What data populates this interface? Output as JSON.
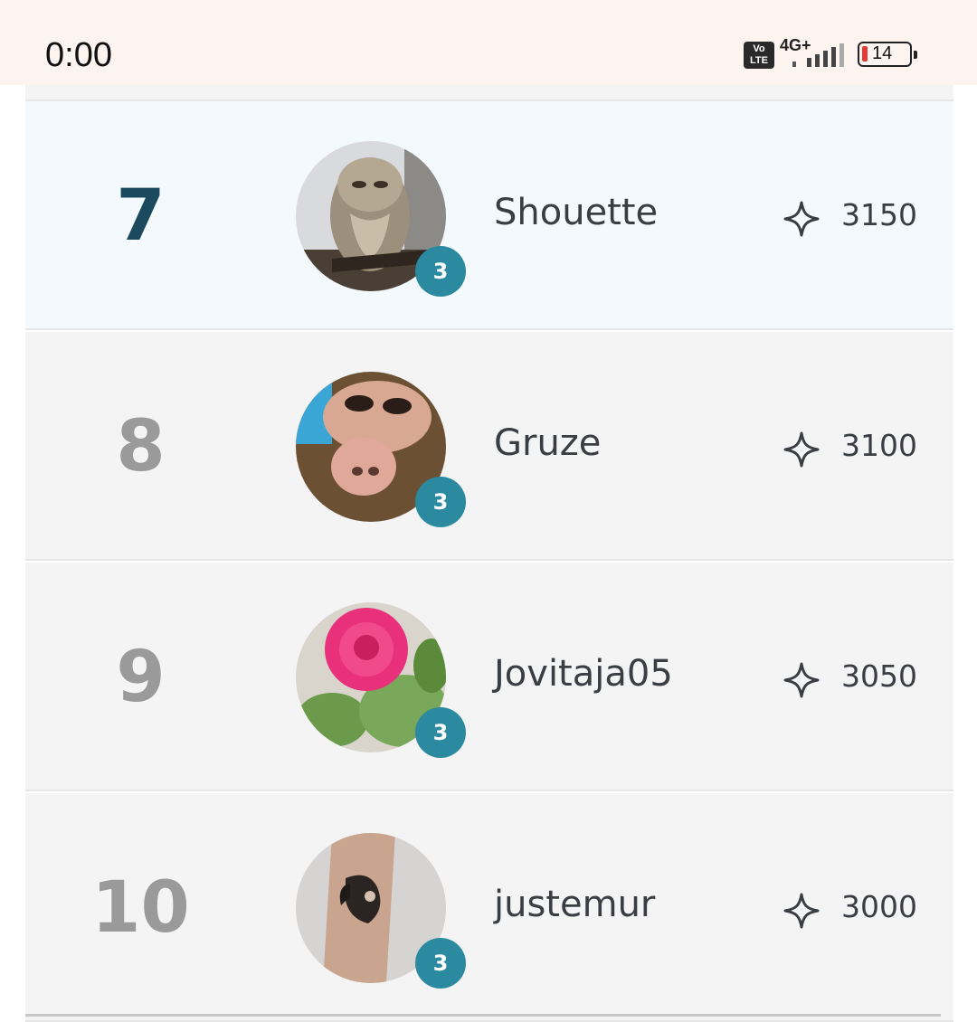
{
  "status_bar": {
    "time": "0:00",
    "volte": "Vo LTE",
    "network": "4G+",
    "battery": "14",
    "battery_color": "#e53935"
  },
  "leaderboard": {
    "accent_color": "#2b8aa0",
    "rows": [
      {
        "rank": "7",
        "username": "Shouette",
        "level": "3",
        "score": "3150",
        "avatar": "owl-photo",
        "highlighted": true
      },
      {
        "rank": "8",
        "username": "Gruze",
        "level": "3",
        "score": "3100",
        "avatar": "alf-puppet-photo",
        "highlighted": false
      },
      {
        "rank": "9",
        "username": "Jovitaja05",
        "level": "3",
        "score": "3050",
        "avatar": "pink-rose-photo",
        "highlighted": false
      },
      {
        "rank": "10",
        "username": "justemur",
        "level": "3",
        "score": "3000",
        "avatar": "tattoo-arm-photo",
        "highlighted": false
      }
    ],
    "score_icon": "sparkle-star-icon"
  }
}
